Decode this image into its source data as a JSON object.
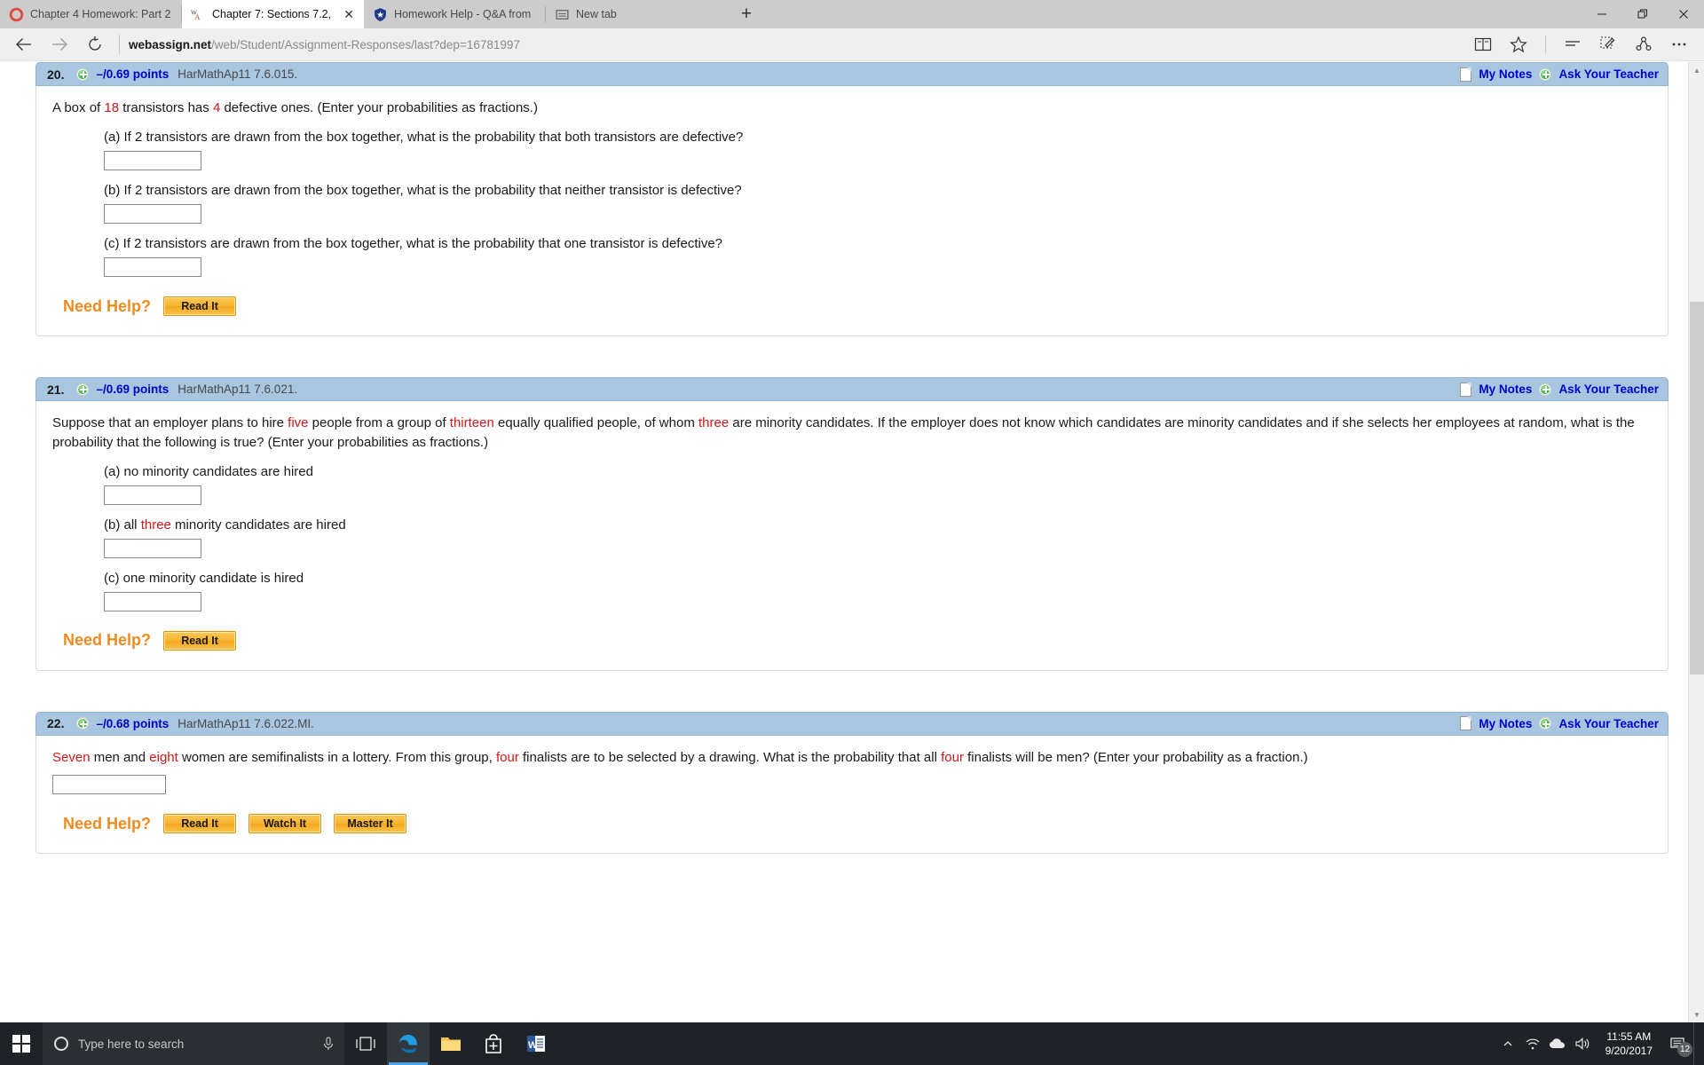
{
  "browser": {
    "tabs": [
      {
        "title": "Chapter 4 Homework: Part 2",
        "favicon": "chrome-circle-icon",
        "active": false
      },
      {
        "title": "Chapter 7: Sections 7.2,",
        "favicon": "webassign-icon",
        "active": true
      },
      {
        "title": "Homework Help - Q&A from",
        "favicon": "shield-icon",
        "active": false
      },
      {
        "title": "New tab",
        "favicon": "newtab-icon",
        "active": false
      }
    ],
    "newtab_label": "+",
    "address": {
      "host": "webassign.net",
      "path": "/web/Student/Assignment-Responses/last?dep=16781997"
    },
    "nav": {
      "back": "back-arrow",
      "forward": "forward-arrow",
      "refresh": "refresh-arrow"
    },
    "toolbar_icons": [
      "reading-view-icon",
      "favorites-star-icon",
      "hub-icon",
      "web-note-icon",
      "share-icon",
      "more-icon"
    ],
    "window_controls": {
      "minimize": "—",
      "restore": "❐",
      "close": "✕"
    }
  },
  "questions": [
    {
      "number": "20.",
      "points": "–/0.69 points",
      "code": "HarMathAp11 7.6.015.",
      "notes_label": "My Notes",
      "ask_label": "Ask Your Teacher",
      "prompt_parts": [
        {
          "t": "A box of ",
          "red": false
        },
        {
          "t": "18",
          "red": true
        },
        {
          "t": " transistors has ",
          "red": false
        },
        {
          "t": "4",
          "red": true
        },
        {
          "t": " defective ones. (Enter your probabilities as fractions.)",
          "red": false
        }
      ],
      "subquestions": [
        {
          "parts": [
            {
              "t": "(a) If 2 transistors are drawn from the box together, what is the probability that both transistors are defective?",
              "red": false
            }
          ],
          "answer": ""
        },
        {
          "parts": [
            {
              "t": "(b) If 2 transistors are drawn from the box together, what is the probability that neither transistor is defective?",
              "red": false
            }
          ],
          "answer": ""
        },
        {
          "parts": [
            {
              "t": "(c) If 2 transistors are drawn from the box together, what is the probability that one transistor is defective?",
              "red": false
            }
          ],
          "answer": ""
        }
      ],
      "need_help_label": "Need Help?",
      "help_buttons": [
        "Read It"
      ]
    },
    {
      "number": "21.",
      "points": "–/0.69 points",
      "code": "HarMathAp11 7.6.021.",
      "notes_label": "My Notes",
      "ask_label": "Ask Your Teacher",
      "prompt_parts": [
        {
          "t": "Suppose that an employer plans to hire ",
          "red": false
        },
        {
          "t": "five",
          "red": true
        },
        {
          "t": " people from a group of ",
          "red": false
        },
        {
          "t": "thirteen",
          "red": true
        },
        {
          "t": " equally qualified people, of whom ",
          "red": false
        },
        {
          "t": "three",
          "red": true
        },
        {
          "t": " are minority candidates. If the employer does not know which candidates are minority candidates and if she selects her employees at random, what is the probability that the following is true? (Enter your probabilities as fractions.)",
          "red": false
        }
      ],
      "subquestions": [
        {
          "parts": [
            {
              "t": "(a) no minority candidates are hired",
              "red": false
            }
          ],
          "answer": ""
        },
        {
          "parts": [
            {
              "t": "(b) all ",
              "red": false
            },
            {
              "t": "three",
              "red": true
            },
            {
              "t": " minority candidates are hired",
              "red": false
            }
          ],
          "answer": ""
        },
        {
          "parts": [
            {
              "t": "(c) one minority candidate is hired",
              "red": false
            }
          ],
          "answer": ""
        }
      ],
      "need_help_label": "Need Help?",
      "help_buttons": [
        "Read It"
      ]
    },
    {
      "number": "22.",
      "points": "–/0.68 points",
      "code": "HarMathAp11 7.6.022.MI.",
      "notes_label": "My Notes",
      "ask_label": "Ask Your Teacher",
      "prompt_parts": [
        {
          "t": "Seven",
          "red": true
        },
        {
          "t": " men and ",
          "red": false
        },
        {
          "t": "eight",
          "red": true
        },
        {
          "t": " women are semifinalists in a lottery. From this group, ",
          "red": false
        },
        {
          "t": "four",
          "red": true
        },
        {
          "t": " finalists are to be selected by a drawing. What is the probability that all ",
          "red": false
        },
        {
          "t": "four",
          "red": true
        },
        {
          "t": " finalists will be men? (Enter your probability as a fraction.)",
          "red": false
        }
      ],
      "inline_answer": "",
      "subquestions": [],
      "need_help_label": "Need Help?",
      "help_buttons": [
        "Read It",
        "Watch It",
        "Master It"
      ]
    }
  ],
  "taskbar": {
    "search_placeholder": "Type here to search",
    "icons": [
      "start-icon",
      "cortana-icon",
      "microphone-icon",
      "task-view-icon",
      "edge-icon",
      "file-explorer-icon",
      "store-icon",
      "word-icon"
    ],
    "tray_icons": [
      "show-hidden-icons",
      "wifi-icon",
      "onedrive-icon",
      "volume-icon"
    ],
    "time": "11:55 AM",
    "date": "9/20/2017",
    "notification_count": "12"
  },
  "colors": {
    "header_band": "#a8c6e0",
    "link_blue": "#0000d0",
    "red_value": "#d01919",
    "help_orange": "#f08a1e"
  }
}
